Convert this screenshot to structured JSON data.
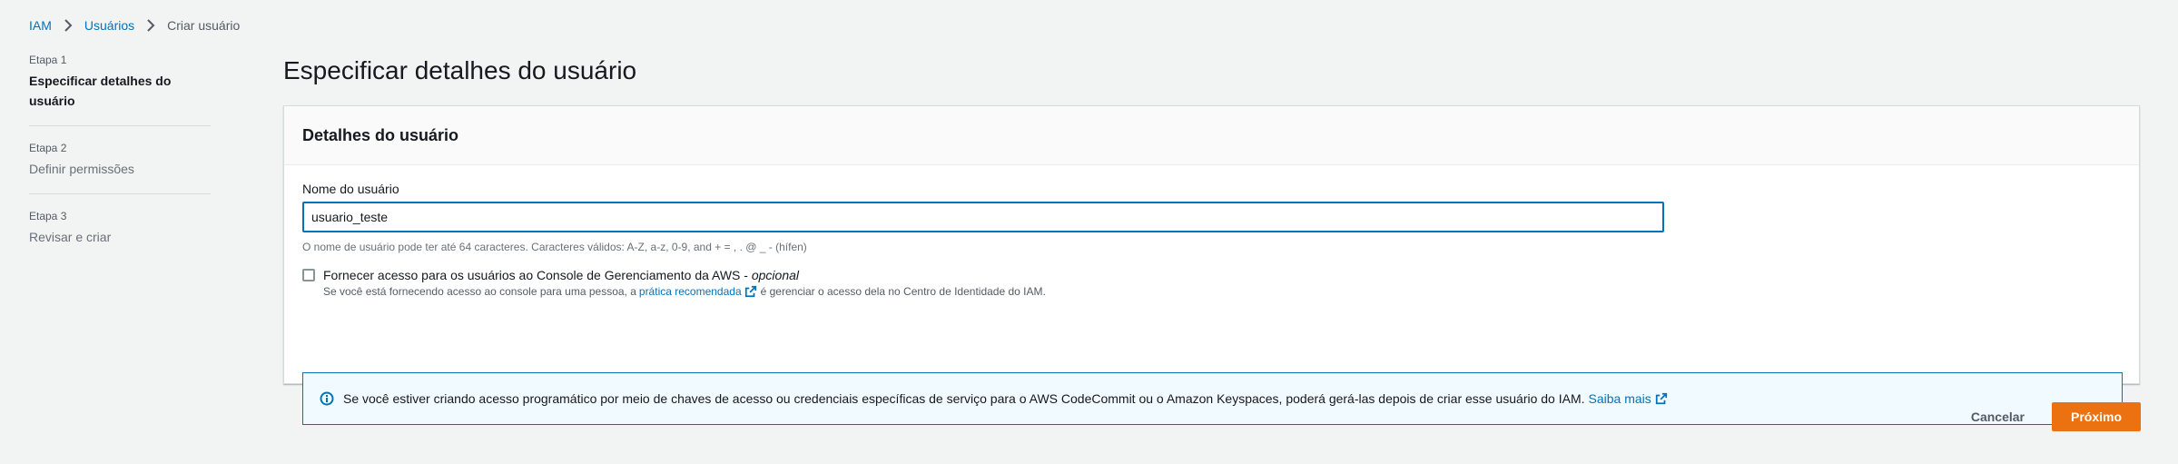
{
  "breadcrumb": {
    "items": [
      "IAM",
      "Usuários"
    ],
    "current": "Criar usuário"
  },
  "steps": [
    {
      "num": "Etapa 1",
      "title": "Especificar detalhes do usuário"
    },
    {
      "num": "Etapa 2",
      "title": "Definir permissões"
    },
    {
      "num": "Etapa 3",
      "title": "Revisar e criar"
    }
  ],
  "page": {
    "title": "Especificar detalhes do usuário"
  },
  "container": {
    "header": "Detalhes do usuário",
    "username_label": "Nome do usuário",
    "username_value": "usuario_teste",
    "username_constraint": "O nome de usuário pode ter até 64 caracteres. Caracteres válidos: A-Z, a-z, 0-9, and + = , . @ _ - (hífen)",
    "console_access": {
      "label": "Fornecer acesso para os usuários ao Console de Gerenciamento da AWS -",
      "optional": "opcional",
      "checked": false,
      "desc_before": "Se você está fornecendo acesso ao console para uma pessoa, a",
      "desc_link": "prática recomendada",
      "desc_after": "é gerenciar o acesso dela no Centro de Identidade do IAM."
    },
    "info_alert": {
      "text": "Se você estiver criando acesso programático por meio de chaves de acesso ou credenciais específicas de serviço para o AWS CodeCommit ou o Amazon Keyspaces, poderá gerá-las depois de criar esse usuário do IAM.",
      "link": "Saiba mais"
    }
  },
  "actions": {
    "cancel": "Cancelar",
    "next": "Próximo"
  },
  "colors": {
    "link": "#0073bb",
    "primary": "#ec7211",
    "background": "#f2f3f3"
  }
}
